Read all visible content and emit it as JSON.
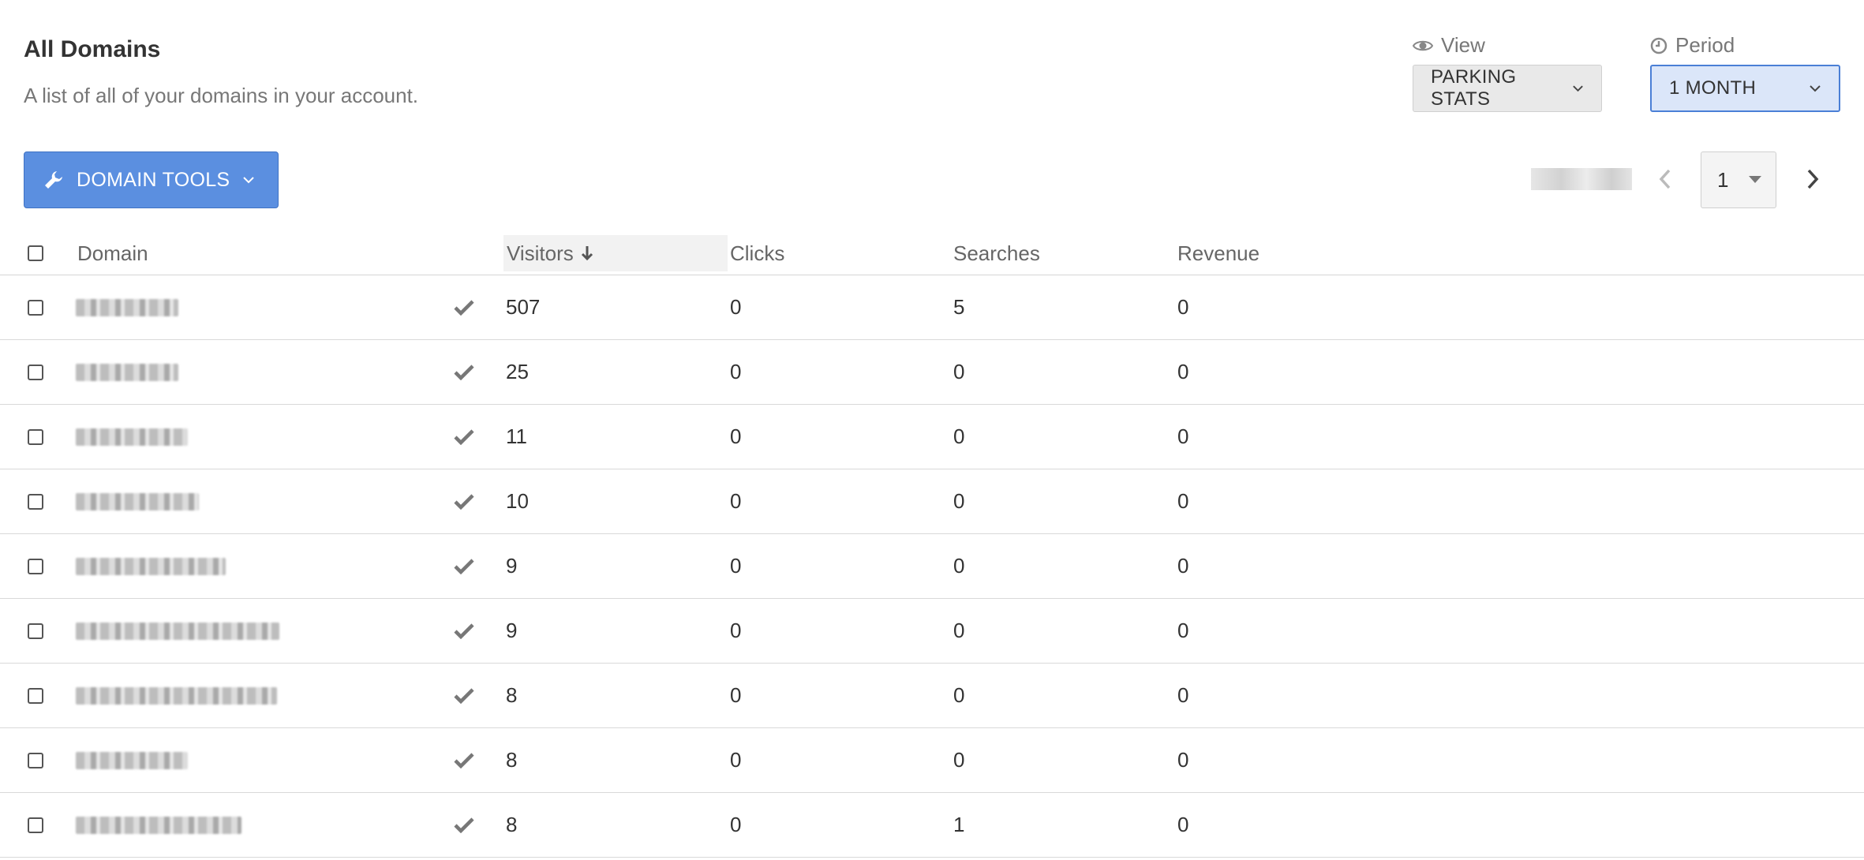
{
  "header": {
    "title": "All Domains",
    "subtitle": "A list of all of your domains in your account."
  },
  "view": {
    "label": "View",
    "icon": "eye-icon",
    "value": "PARKING STATS"
  },
  "period": {
    "label": "Period",
    "icon": "clock-icon",
    "value": "1 MONTH"
  },
  "toolbar": {
    "tools_label": "DOMAIN TOOLS",
    "tools_icon": "wrench-icon"
  },
  "pagination": {
    "current_page": "1"
  },
  "table": {
    "columns": {
      "domain": "Domain",
      "visitors": "Visitors",
      "clicks": "Clicks",
      "searches": "Searches",
      "revenue": "Revenue"
    },
    "sort": {
      "column": "visitors",
      "direction": "descending"
    },
    "rows": [
      {
        "visitors": "507",
        "clicks": "0",
        "searches": "5",
        "revenue": "0"
      },
      {
        "visitors": "25",
        "clicks": "0",
        "searches": "0",
        "revenue": "0"
      },
      {
        "visitors": "11",
        "clicks": "0",
        "searches": "0",
        "revenue": "0"
      },
      {
        "visitors": "10",
        "clicks": "0",
        "searches": "0",
        "revenue": "0"
      },
      {
        "visitors": "9",
        "clicks": "0",
        "searches": "0",
        "revenue": "0"
      },
      {
        "visitors": "9",
        "clicks": "0",
        "searches": "0",
        "revenue": "0"
      },
      {
        "visitors": "8",
        "clicks": "0",
        "searches": "0",
        "revenue": "0"
      },
      {
        "visitors": "8",
        "clicks": "0",
        "searches": "0",
        "revenue": "0"
      },
      {
        "visitors": "8",
        "clicks": "0",
        "searches": "1",
        "revenue": "0"
      }
    ]
  },
  "colors": {
    "primary_button": "#5b8fe0",
    "active_select_bg": "#dbe6f9",
    "active_select_border": "#4a7fd6"
  }
}
